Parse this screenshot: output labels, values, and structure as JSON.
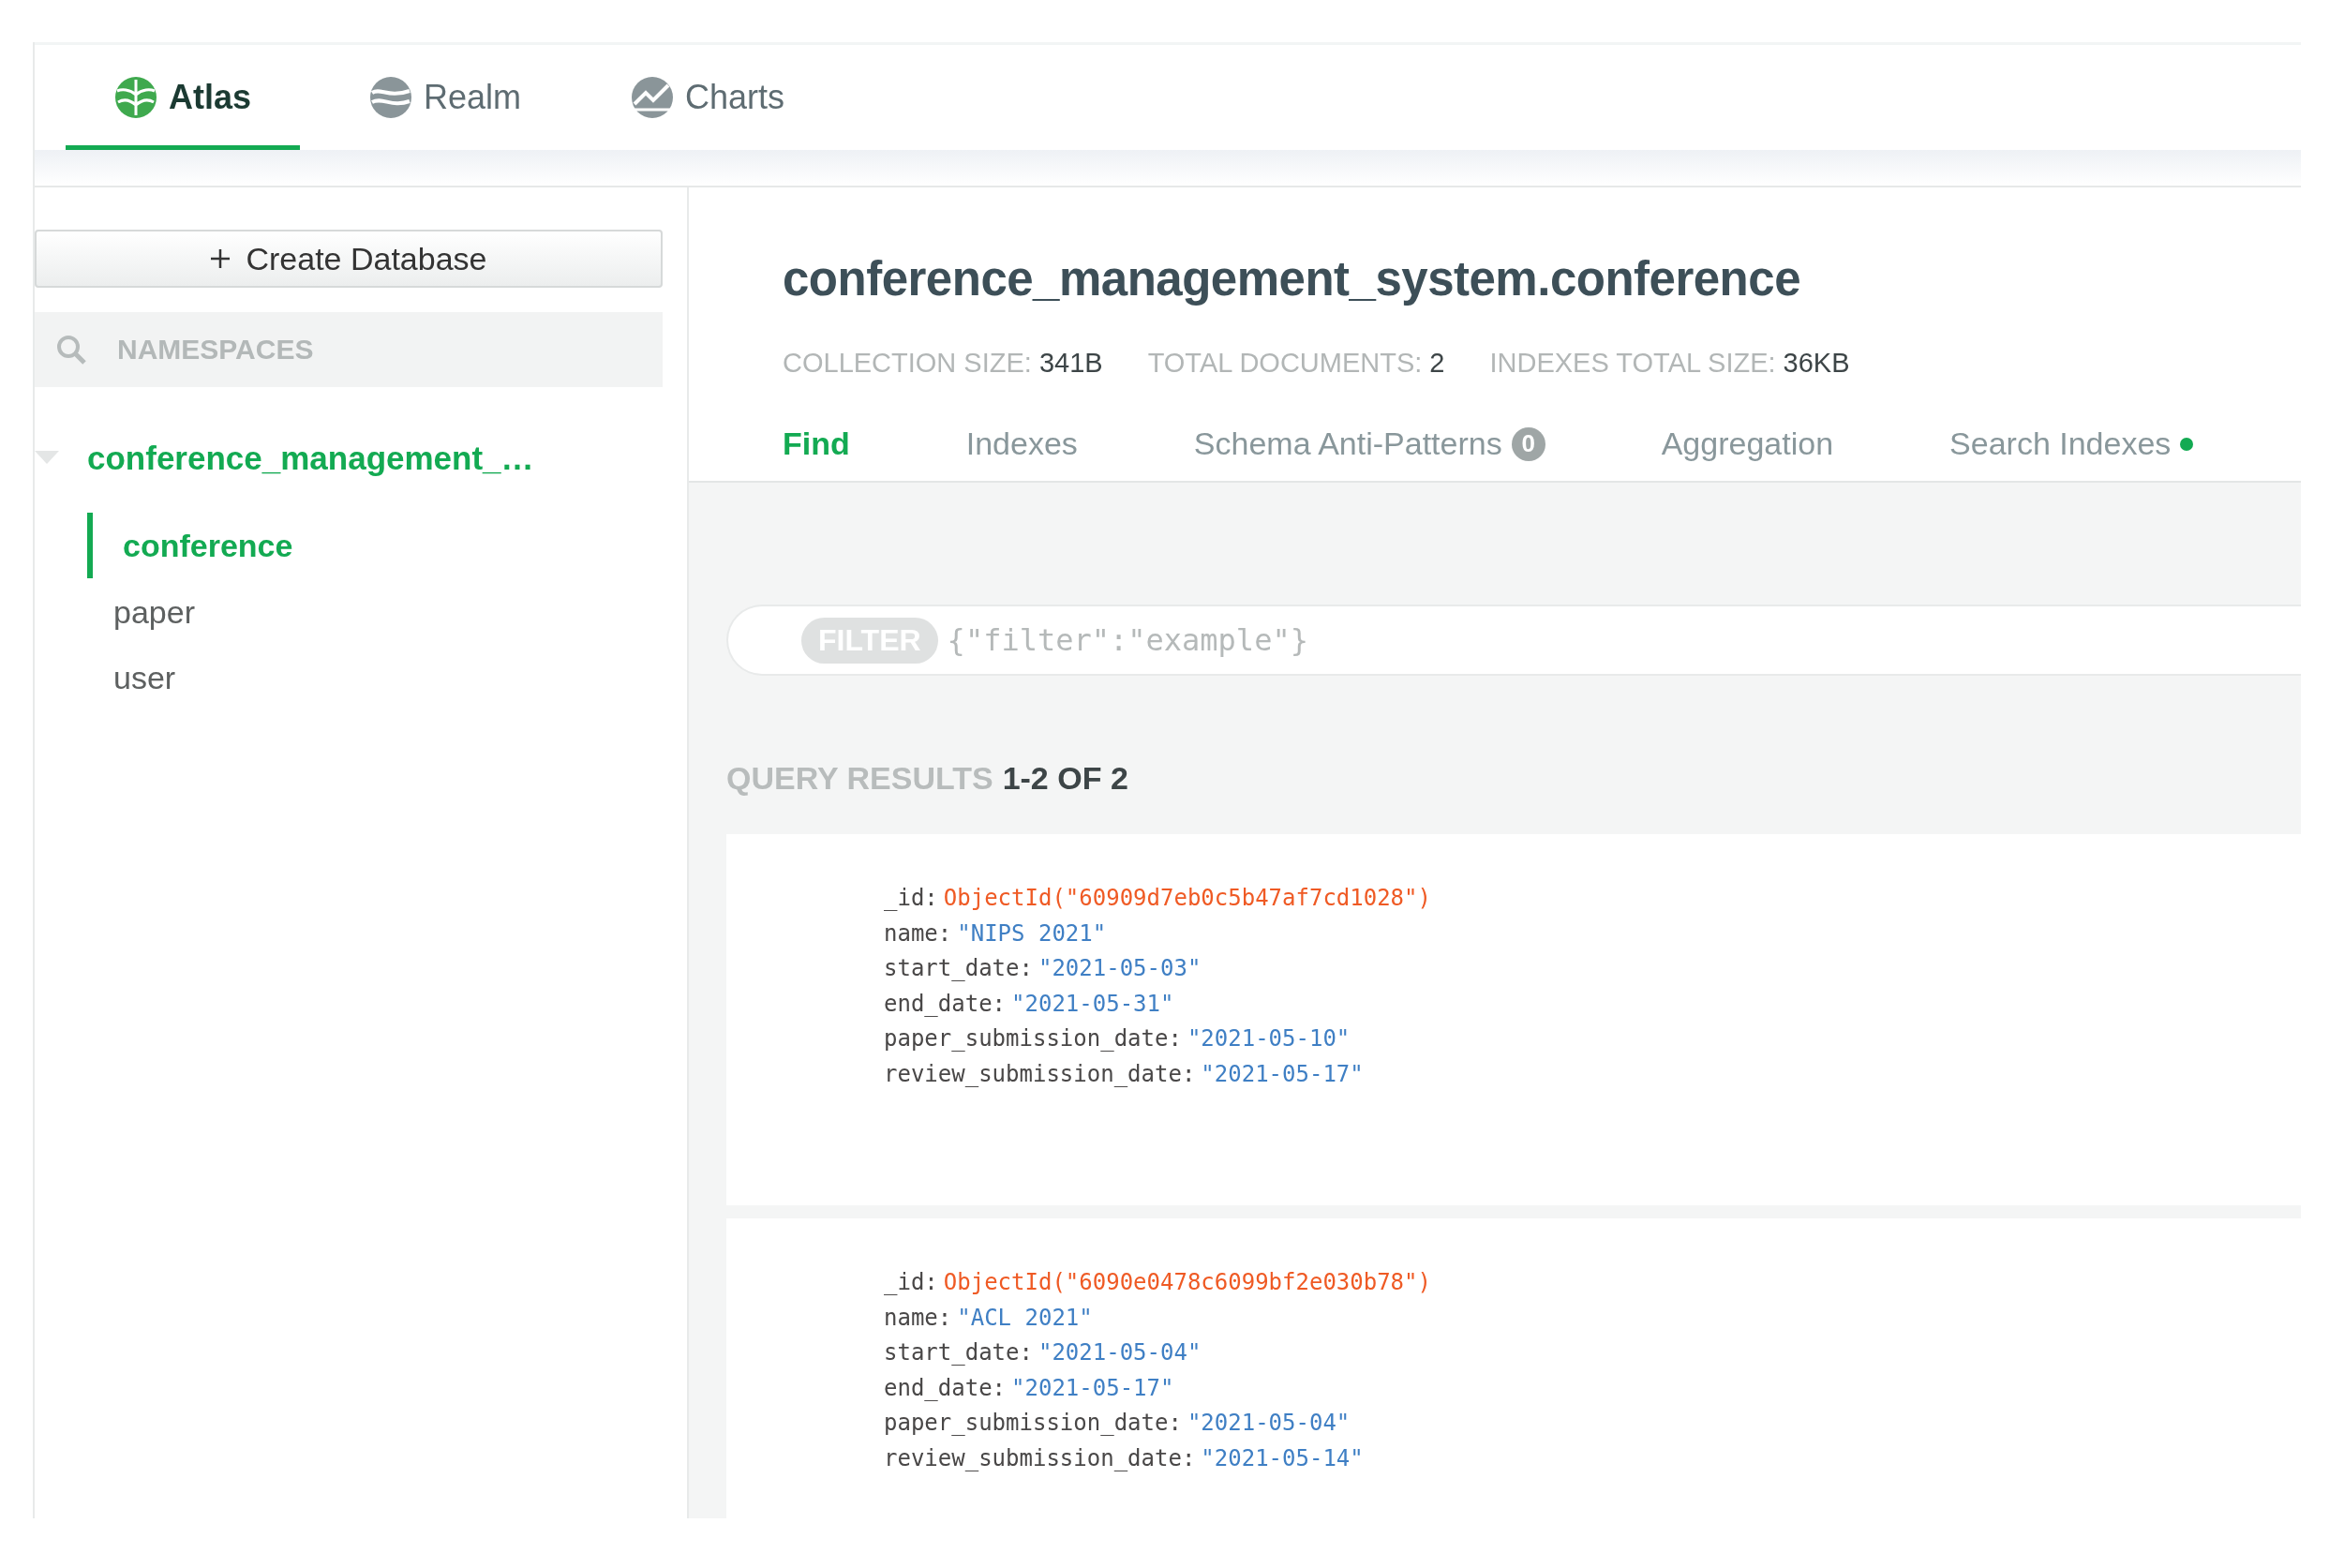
{
  "products": [
    {
      "label": "Atlas",
      "selected": true,
      "kind": "atlas"
    },
    {
      "label": "Realm",
      "selected": false,
      "kind": "realm"
    },
    {
      "label": "Charts",
      "selected": false,
      "kind": "charts"
    }
  ],
  "sidebar": {
    "create_button": "Create Database",
    "search": {
      "placeholder": "NAMESPACES"
    },
    "databases": [
      {
        "name": "conference_management_…",
        "expanded": true,
        "children": [
          {
            "name": "conference",
            "selected": true
          },
          {
            "name": "paper",
            "selected": false
          },
          {
            "name": "user",
            "selected": false
          }
        ]
      }
    ]
  },
  "collection": {
    "title": "conference_management_system.conference",
    "stats": [
      {
        "label": "COLLECTION SIZE:",
        "value": "341B"
      },
      {
        "label": "TOTAL DOCUMENTS:",
        "value": "2"
      },
      {
        "label": "INDEXES TOTAL SIZE:",
        "value": "36KB"
      }
    ],
    "tabs": [
      {
        "label": "Find",
        "selected": true
      },
      {
        "label": "Indexes",
        "selected": false
      },
      {
        "label": "Schema Anti-Patterns",
        "selected": false,
        "badge": "0"
      },
      {
        "label": "Aggregation",
        "selected": false
      },
      {
        "label": "Search Indexes",
        "selected": false,
        "status_dot": true
      }
    ]
  },
  "filter": {
    "label": "FILTER",
    "placeholder": "{\"filter\":\"example\"}"
  },
  "results": {
    "label": "QUERY RESULTS",
    "range": "1-2 OF 2"
  },
  "documents": [
    {
      "fields": [
        {
          "key": "_id:",
          "value": "ObjectId(\"60909d7eb0c5b47af7cd1028\")",
          "kind": "objectid"
        },
        {
          "key": "name:",
          "value": "\"NIPS 2021\"",
          "kind": "string"
        },
        {
          "key": "start_date:",
          "value": "\"2021-05-03\"",
          "kind": "string"
        },
        {
          "key": "end_date:",
          "value": "\"2021-05-31\"",
          "kind": "string"
        },
        {
          "key": "paper_submission_date:",
          "value": "\"2021-05-10\"",
          "kind": "string"
        },
        {
          "key": "review_submission_date:",
          "value": "\"2021-05-17\"",
          "kind": "string"
        }
      ]
    },
    {
      "fields": [
        {
          "key": "_id:",
          "value": "ObjectId(\"6090e0478c6099bf2e030b78\")",
          "kind": "objectid"
        },
        {
          "key": "name:",
          "value": "\"ACL 2021\"",
          "kind": "string"
        },
        {
          "key": "start_date:",
          "value": "\"2021-05-04\"",
          "kind": "string"
        },
        {
          "key": "end_date:",
          "value": "\"2021-05-17\"",
          "kind": "string"
        },
        {
          "key": "paper_submission_date:",
          "value": "\"2021-05-04\"",
          "kind": "string"
        },
        {
          "key": "review_submission_date:",
          "value": "\"2021-05-14\"",
          "kind": "string"
        }
      ]
    }
  ]
}
